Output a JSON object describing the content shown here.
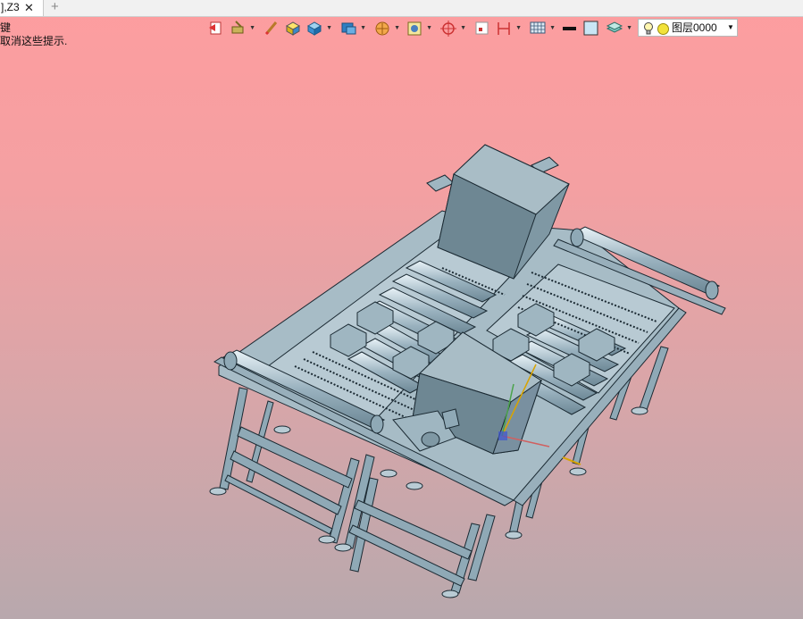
{
  "tab": {
    "title": "],Z3",
    "close_glyph": "✕",
    "new_glyph": "+"
  },
  "hints": {
    "line1": "键",
    "line1_prefix": "•",
    "line2": "取消这些提示."
  },
  "toolbar": {
    "items": [
      {
        "name": "exit-icon"
      },
      {
        "name": "render-mode-icon"
      },
      {
        "name": "pen-icon"
      },
      {
        "name": "shaded-cube-icon"
      },
      {
        "name": "view-cube-icon"
      },
      {
        "name": "display-style-icon"
      },
      {
        "name": "section-icon"
      },
      {
        "name": "snapshot-icon"
      },
      {
        "name": "orient-icon"
      },
      {
        "name": "frame-icon"
      },
      {
        "name": "dimension-icon"
      },
      {
        "name": "grid-icon"
      },
      {
        "name": "line-color-icon"
      },
      {
        "name": "fill-color-icon"
      },
      {
        "name": "layer-manager-icon"
      }
    ],
    "layer": {
      "value": "图层0000"
    }
  }
}
